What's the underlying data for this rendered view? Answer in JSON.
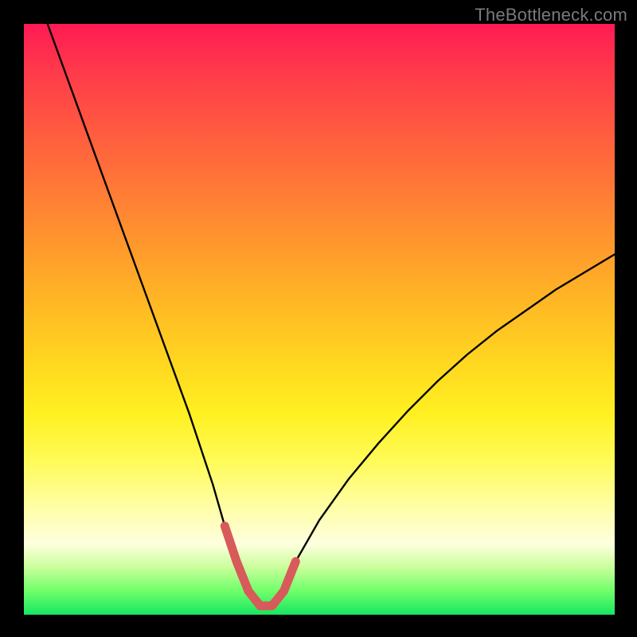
{
  "watermark": "TheBottleneck.com",
  "colors": {
    "page_bg": "#000000",
    "curve_stroke": "#000000",
    "highlight_stroke": "#d85a5a",
    "gradient_stops": [
      "#ff1a54",
      "#ff7a36",
      "#ffd920",
      "#fffea8",
      "#17e662"
    ]
  },
  "chart_data": {
    "type": "line",
    "title": "",
    "xlabel": "",
    "ylabel": "",
    "xlim": [
      0,
      100
    ],
    "ylim": [
      0,
      100
    ],
    "series": [
      {
        "name": "bottleneck-curve",
        "x": [
          4,
          8,
          12,
          16,
          20,
          24,
          28,
          32,
          34,
          36,
          38,
          40,
          42,
          44,
          46,
          50,
          55,
          60,
          65,
          70,
          75,
          80,
          85,
          90,
          95,
          100
        ],
        "y": [
          100,
          89,
          78,
          67,
          56,
          45,
          34,
          22,
          15,
          9,
          4,
          1.5,
          1.5,
          4,
          9,
          16,
          23,
          29,
          34.5,
          39.5,
          44,
          48,
          51.5,
          55,
          58,
          61
        ]
      }
    ],
    "highlight_range": {
      "name": "optimal-zone",
      "x": [
        34,
        36,
        38,
        40,
        42,
        44,
        46
      ],
      "y": [
        15,
        9,
        4,
        1.5,
        1.5,
        4,
        9
      ]
    }
  }
}
